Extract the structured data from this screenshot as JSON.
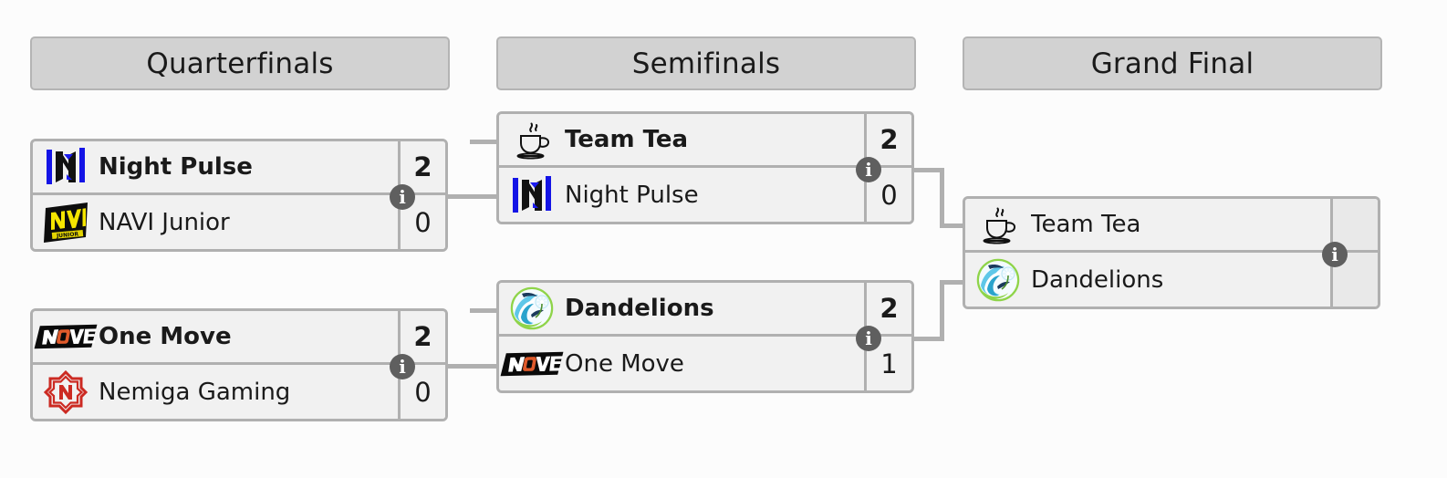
{
  "rounds": [
    {
      "label": "Quarterfinals"
    },
    {
      "label": "Semifinals"
    },
    {
      "label": "Grand Final"
    }
  ],
  "matches": {
    "qf1": {
      "info_label": "i",
      "teams": [
        {
          "name": "Night Pulse",
          "score": "2",
          "logo": "night-pulse-logo",
          "winner": true
        },
        {
          "name": "NAVI Junior",
          "score": "0",
          "logo": "navi-junior-logo",
          "winner": false
        }
      ]
    },
    "qf2": {
      "info_label": "i",
      "teams": [
        {
          "name": "One Move",
          "score": "2",
          "logo": "one-move-logo",
          "winner": true
        },
        {
          "name": "Nemiga Gaming",
          "score": "0",
          "logo": "nemiga-logo",
          "winner": false
        }
      ]
    },
    "sf1": {
      "info_label": "i",
      "teams": [
        {
          "name": "Team Tea",
          "score": "2",
          "logo": "team-tea-logo",
          "winner": true
        },
        {
          "name": "Night Pulse",
          "score": "0",
          "logo": "night-pulse-logo",
          "winner": false
        }
      ]
    },
    "sf2": {
      "info_label": "i",
      "teams": [
        {
          "name": "Dandelions",
          "score": "2",
          "logo": "dandelions-logo",
          "winner": true
        },
        {
          "name": "One Move",
          "score": "1",
          "logo": "one-move-logo",
          "winner": false
        }
      ]
    },
    "gf": {
      "info_label": "i",
      "teams": [
        {
          "name": "Team Tea",
          "score": "",
          "logo": "team-tea-logo",
          "winner": false
        },
        {
          "name": "Dandelions",
          "score": "",
          "logo": "dandelions-logo",
          "winner": false
        }
      ]
    }
  },
  "colors": {
    "page_background": "#fcfcfc",
    "header_fill": "#d2d2d2",
    "header_border": "#b4b4b4",
    "box_border": "#b0b0b0",
    "row_fill": "#f1f1f1",
    "empty_score_fill": "#e9e9e9",
    "info_badge": "#5f5f5f",
    "text": "#1a1a1a"
  }
}
